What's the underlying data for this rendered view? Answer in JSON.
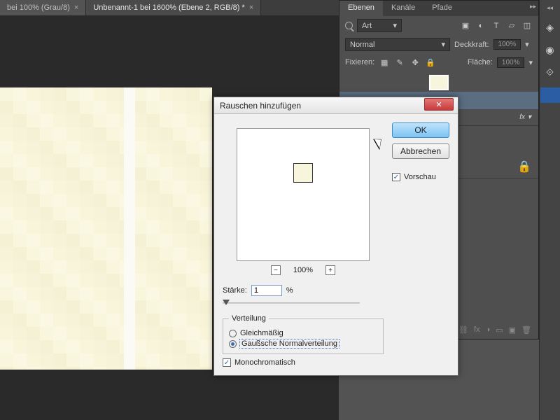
{
  "tabs": [
    {
      "label": "bei 100% (Grau/8)",
      "close": "×"
    },
    {
      "label": "Unbenannt-1 bei 1600% (Ebene 2, RGB/8) *",
      "close": "×"
    }
  ],
  "panel": {
    "tabs": [
      "Ebenen",
      "Kanäle",
      "Pfade"
    ],
    "filter": "Art",
    "mode": "Normal",
    "opacity_label": "Deckkraft:",
    "opacity": "100%",
    "lock_label": "Fixieren:",
    "fill_label": "Fläche:",
    "fill": "100%",
    "fx": "fx"
  },
  "dialog": {
    "title": "Rauschen hinzufügen",
    "ok": "OK",
    "cancel": "Abbrechen",
    "preview": "Vorschau",
    "zoom": "100%",
    "strength_label": "Stärke:",
    "strength_value": "1",
    "percent": "%",
    "dist_legend": "Verteilung",
    "dist_uniform": "Gleichmäßig",
    "dist_gauss": "Gaußsche Normalverteilung",
    "mono": "Monochromatisch"
  }
}
